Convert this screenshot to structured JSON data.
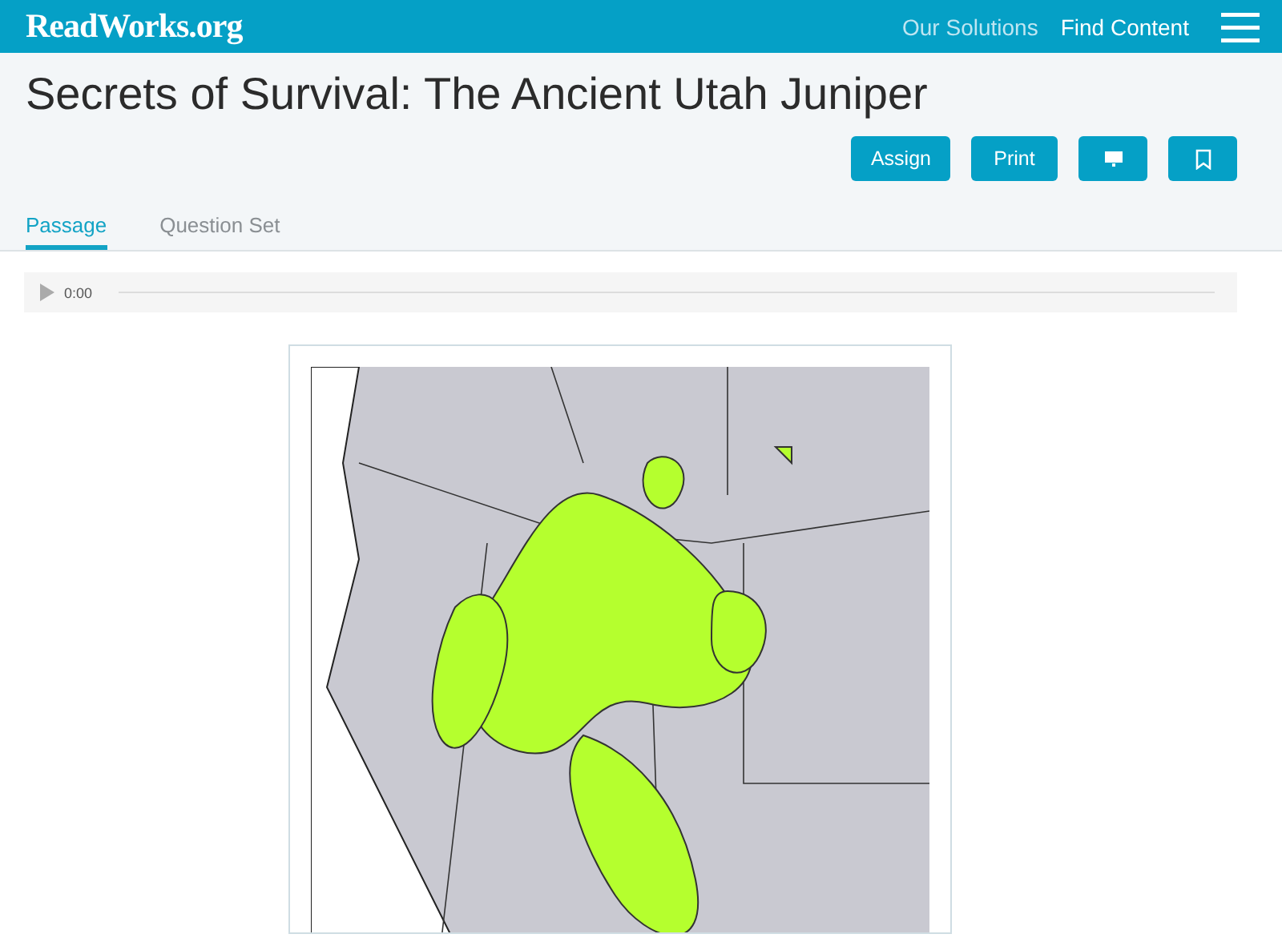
{
  "header": {
    "logo": "ReadWorks.org",
    "nav": [
      "Our Solutions",
      "Find Content"
    ]
  },
  "title": "Secrets of Survival: The Ancient Utah Juniper",
  "actions": [
    {
      "kind": "text",
      "label": "Assign"
    },
    {
      "kind": "text",
      "label": "Print"
    },
    {
      "kind": "present"
    },
    {
      "kind": "bookmark"
    }
  ],
  "tabs": [
    {
      "label": "Passage",
      "selected": true
    },
    {
      "label": "Question Set",
      "selected": false
    }
  ],
  "audio": {
    "time": "0:00"
  }
}
